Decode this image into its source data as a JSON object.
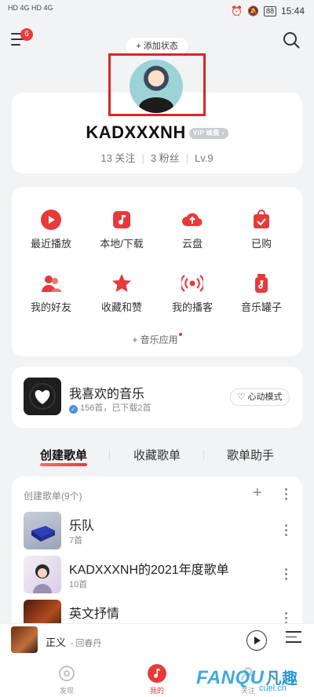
{
  "status_bar": {
    "left_text": "HD 4G HD 4G",
    "battery": "88",
    "time": "15:44"
  },
  "header": {
    "menu_badge": "6",
    "add_status": "+ 添加状态"
  },
  "profile": {
    "name": "KADXXXNH",
    "vip_label": "VIP 续费 ›",
    "following": "13 关注",
    "fans": "3 粉丝",
    "level": "Lv.9"
  },
  "quick_grid": {
    "items": [
      {
        "label": "最近播放",
        "icon": "recent-play-icon"
      },
      {
        "label": "本地/下载",
        "icon": "local-download-icon"
      },
      {
        "label": "云盘",
        "icon": "cloud-drive-icon"
      },
      {
        "label": "已购",
        "icon": "purchased-icon"
      },
      {
        "label": "我的好友",
        "icon": "friends-icon"
      },
      {
        "label": "收藏和赞",
        "icon": "favorites-star-icon"
      },
      {
        "label": "我的播客",
        "icon": "podcast-icon"
      },
      {
        "label": "音乐罐子",
        "icon": "music-jar-icon"
      }
    ],
    "add_app": "+ 音乐应用"
  },
  "liked": {
    "title": "我喜欢的音乐",
    "subtitle": "156首，已下载2首",
    "heart_mode": "♡ 心动模式"
  },
  "tabs": [
    "创建歌单",
    "收藏歌单",
    "歌单助手"
  ],
  "playlists": {
    "header": "创建歌单(9个)",
    "items": [
      {
        "name": "乐队",
        "count": "7首"
      },
      {
        "name": "KADXXXNH的2021年度歌单",
        "count": "10首"
      },
      {
        "name": "英文抒情",
        "count": ""
      }
    ]
  },
  "mini_player": {
    "title": "正义",
    "artist": "- 回春丹"
  },
  "bottom_nav": [
    {
      "label": "发现"
    },
    {
      "label": "我的"
    },
    {
      "label": "关注"
    }
  ],
  "watermark": {
    "brand": "FANQU",
    "cn": "凡趣",
    "domain": "cuel.cn"
  },
  "colors": {
    "accent": "#e73a3a",
    "background": "#f2f3f5",
    "highlight_frame": "#d9262a"
  }
}
